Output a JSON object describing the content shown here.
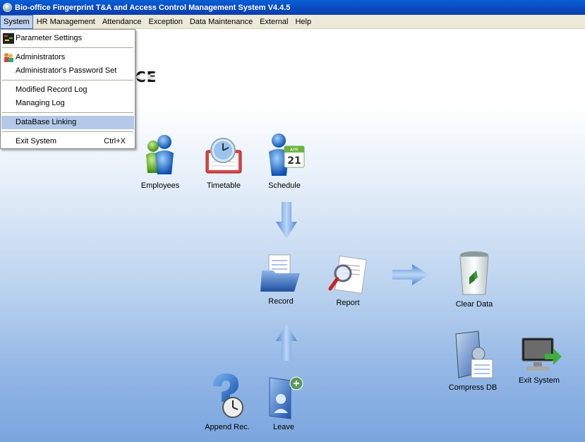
{
  "window": {
    "title": "Bio-office Fingerprint T&A and Access Control Management System V4.4.5"
  },
  "menubar": {
    "items": [
      "System",
      "HR Management",
      "Attendance",
      "Exception",
      "Data Maintenance",
      "External",
      "Help"
    ],
    "active": "System"
  },
  "system_menu": {
    "parameter_settings": "Parameter Settings",
    "administrators": "Administrators",
    "admin_password_set": "Administrator's Password Set",
    "modified_record_log": "Modified Record Log",
    "managing_log": "Managing Log",
    "database_linking": "DataBase Linking",
    "exit_system": "Exit System",
    "exit_shortcut": "Ctrl+X",
    "highlighted": "DataBase Linking"
  },
  "workspace": {
    "logo_fragment": "CE",
    "tiles": {
      "employees": "Employees",
      "timetable": "Timetable",
      "schedule": "Schedule",
      "schedule_calendar_day": "21",
      "schedule_calendar_month": "APR",
      "record": "Record",
      "report": "Report",
      "clear_data": "Clear Data",
      "compress_db": "Compress DB",
      "exit_system": "Exit System",
      "append_rec": "Append Rec.",
      "leave": "Leave"
    }
  },
  "colors": {
    "titlebar": "#0a48bf",
    "menu_highlight": "#b4c9e8",
    "flow_arrow": "#6f9fdc"
  }
}
